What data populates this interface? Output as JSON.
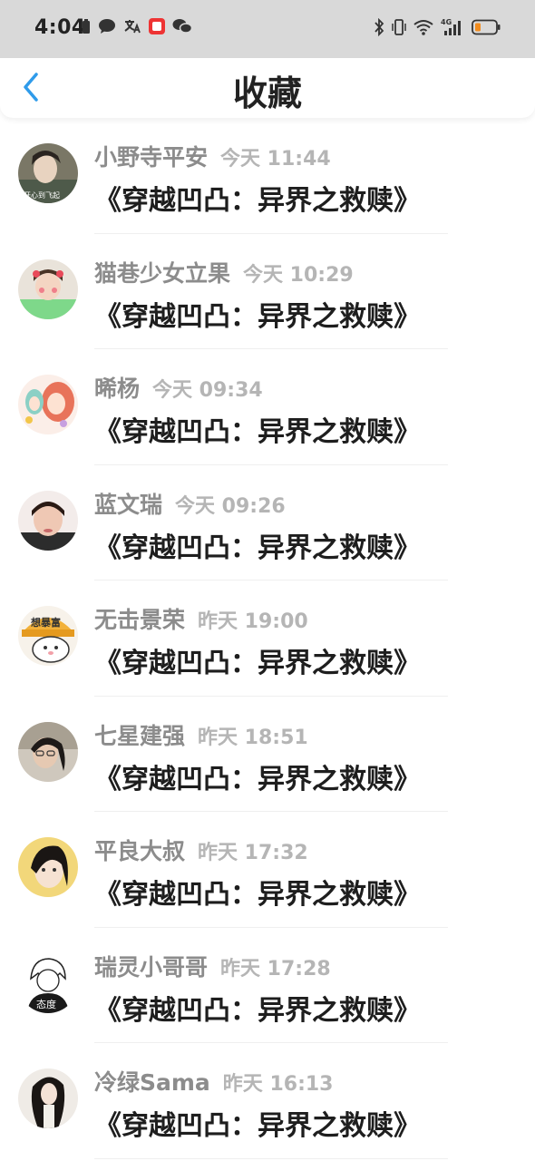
{
  "status_bar": {
    "time": "4:04",
    "left_icons": [
      "battery-saver-icon",
      "chat-bubble-icon",
      "translate-icon",
      "red-app-icon",
      "wechat-icon"
    ],
    "right_icons": [
      "bluetooth-icon",
      "vibrate-icon",
      "wifi-icon",
      "signal-4g-icon",
      "battery-low-icon"
    ],
    "network_label": "4G"
  },
  "header": {
    "title": "收藏",
    "back_icon": "chevron-left-icon",
    "accent_color": "#2f9bea"
  },
  "items": [
    {
      "name": "小野寺平安",
      "time": "今天 11:44",
      "message": "《穿越凹凸：异界之救赎》",
      "avatar_color": "#6b6b5a",
      "avatar_text": "开心到飞起"
    },
    {
      "name": "猫巷少女立果",
      "time": "今天 10:29",
      "message": "《穿越凹凸：异界之救赎》",
      "avatar_color": "#7ed88a"
    },
    {
      "name": "晞杨",
      "time": "今天 09:34",
      "message": "《穿越凹凸：异界之救赎》",
      "avatar_color": "#f2d0c8"
    },
    {
      "name": "蓝文瑞",
      "time": "今天 09:26",
      "message": "《穿越凹凸：异界之救赎》",
      "avatar_color": "#d9b8a8"
    },
    {
      "name": "无击景荣",
      "time": "昨天 19:00",
      "message": "《穿越凹凸：异界之救赎》",
      "avatar_color": "#f2b13a",
      "avatar_text": "想暴富"
    },
    {
      "name": "七星建强",
      "time": "昨天 18:51",
      "message": "《穿越凹凸：异界之救赎》",
      "avatar_color": "#9a9080"
    },
    {
      "name": "平良大叔",
      "time": "昨天 17:32",
      "message": "《穿越凹凸：异界之救赎》",
      "avatar_color": "#f0c24a"
    },
    {
      "name": "瑞灵小哥哥",
      "time": "昨天 17:28",
      "message": "《穿越凹凸：异界之救赎》",
      "avatar_color": "#e8e8e8",
      "avatar_text": "态度"
    },
    {
      "name": "冷绿Sama",
      "time": "昨天 16:13",
      "message": "《穿越凹凸：异界之救赎》",
      "avatar_color": "#d8d2cc"
    }
  ]
}
